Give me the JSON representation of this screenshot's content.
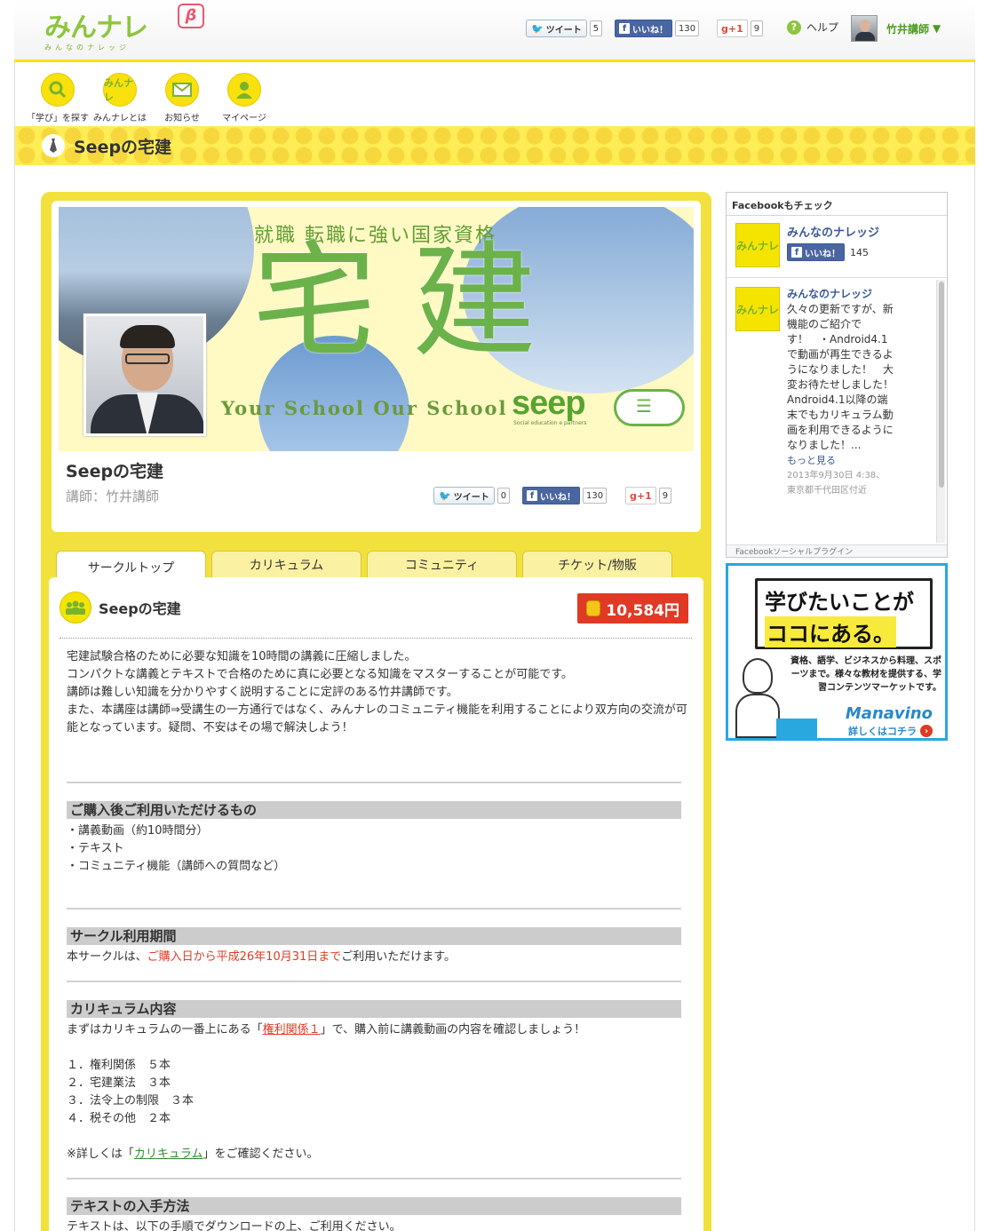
{
  "header": {
    "logo_text": "みんナレ",
    "logo_sub": "みんなのナレッジ",
    "beta": "β",
    "share": {
      "tweet_label": "ツイート",
      "tweet_count": "5",
      "like_label": "いいね！",
      "like_count": "130",
      "gplus_label": "g+1",
      "gplus_count": "9"
    },
    "help_label": "ヘルプ",
    "user_name": "竹井講師",
    "user_caret": "▼"
  },
  "nav": {
    "items": [
      {
        "label": "「学び」を探す",
        "icon": "search-icon"
      },
      {
        "label": "みんナレとは",
        "icon": "logo-icon"
      },
      {
        "label": "お知らせ",
        "icon": "mail-icon"
      },
      {
        "label": "マイページ",
        "icon": "user-icon"
      }
    ]
  },
  "page_title": "Seepの宅建",
  "profile": {
    "banner": {
      "top_text": "就職 転職に強い国家資格",
      "big_text": "宅建",
      "school_text": "Your School Our School",
      "brand": "seep",
      "brand_sub": "Social education e partners"
    },
    "name": "Seepの宅建",
    "teacher": "講師：竹井講師",
    "share": {
      "tweet_label": "ツイート",
      "tweet_count": "0",
      "like_label": "いいね！",
      "like_count": "130",
      "gplus_label": "g+1",
      "gplus_count": "9"
    }
  },
  "tabs": [
    {
      "label": "サークルトップ",
      "active": true
    },
    {
      "label": "カリキュラム",
      "active": false
    },
    {
      "label": "コミュニティ",
      "active": false
    },
    {
      "label": "チケット/物販",
      "active": false
    }
  ],
  "content": {
    "title": "Seepの宅建",
    "price": "10,584円",
    "description": [
      "宅建試験合格のために必要な知識を10時間の講義に圧縮しました。",
      "コンパクトな講義とテキストで合格のために真に必要となる知識をマスターすることが可能です。",
      "講師は難しい知識を分かりやすく説明することに定評のある竹井講師です。",
      "また、本講座は講師⇒受講生の一方通行ではなく、みんナレのコミュニティ機能を利用することにより双方向の交流が可能となっています。疑問、不安はその場で解決しよう！"
    ],
    "section1": {
      "title": "ご購入後ご利用いただけるもの",
      "items": [
        "・講義動画（約10時間分）",
        "・テキスト",
        "・コミュニティ機能（講師への質問など）"
      ]
    },
    "section2": {
      "title": "サークル利用期間",
      "text_pre": "本サークルは、",
      "text_red": "ご購入日から平成26年10月31日まで",
      "text_post": "ご利用いただけます。"
    },
    "section3": {
      "title": "カリキュラム内容",
      "intro_pre": "まずはカリキュラムの一番上にある「",
      "intro_link": "権利関係１",
      "intro_post": "」で、購入前に講義動画の内容を確認しましょう！",
      "items": [
        "１．権利関係　５本",
        "２．宅建業法　３本",
        "３．法令上の制限　３本",
        "４．税その他　２本"
      ],
      "note_pre": "※詳しくは「",
      "note_link": "カリキュラム",
      "note_post": "」をご確認ください。"
    },
    "section4": {
      "title": "テキストの入手方法",
      "text": "テキストは、以下の手順でダウンロードの上、ご利用ください。"
    }
  },
  "facebook": {
    "header": "Facebookもチェック",
    "page_name": "みんなのナレッジ",
    "like_label": "いいね！",
    "like_count": "145",
    "post_name": "みんなのナレッジ",
    "post_text": "久々の更新ですが、新機能のご紹介です！　・Android4.1で動画が再生できるようになりました！　大変お待たせしました！Android4.1以降の端末でもカリキュラム動画を利用できるようになりました！...",
    "more": "もっと見る",
    "date": "2013年9月30日 4:38、東京都千代田区付近",
    "footer": "Facebookソーシャルプラグイン"
  },
  "ad": {
    "line1": "学びたいことが",
    "line2": "ココにある。",
    "body": "資格、語学、ビジネスから料理、スポーツまで。様々な教材を提供する、学習コンテンツマーケットです。",
    "brand": "Manavino",
    "cta": "詳しくはコチラ"
  }
}
